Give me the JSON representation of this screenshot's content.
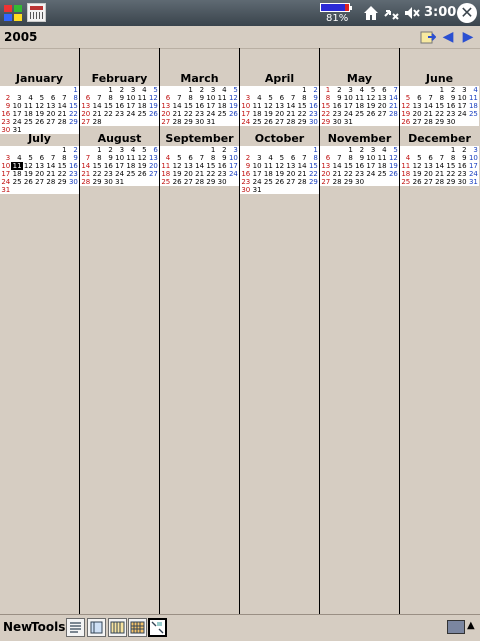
{
  "status": {
    "battery_label": "81%",
    "time": "3:00",
    "icons": [
      "windows-flag-icon",
      "calendar-app-icon",
      "battery-icon",
      "home-icon",
      "connectivity-icon",
      "volume-muted-icon",
      "close-icon"
    ]
  },
  "header": {
    "year": "2005",
    "today_icon": "go-to-today-icon",
    "prev_icon": "◀",
    "next_icon": "▶"
  },
  "months": [
    {
      "name": "January",
      "start": 6,
      "days": 31
    },
    {
      "name": "February",
      "start": 2,
      "days": 28
    },
    {
      "name": "March",
      "start": 2,
      "days": 31
    },
    {
      "name": "April",
      "start": 5,
      "days": 30
    },
    {
      "name": "May",
      "start": 0,
      "days": 31
    },
    {
      "name": "June",
      "start": 3,
      "days": 30
    },
    {
      "name": "July",
      "start": 5,
      "days": 31,
      "today": 11
    },
    {
      "name": "August",
      "start": 1,
      "days": 31
    },
    {
      "name": "September",
      "start": 4,
      "days": 30
    },
    {
      "name": "October",
      "start": 6,
      "days": 31
    },
    {
      "name": "November",
      "start": 2,
      "days": 30
    },
    {
      "name": "December",
      "start": 4,
      "days": 31
    }
  ],
  "toolbar": {
    "new_label": "New",
    "tools_label": "Tools",
    "views": [
      "agenda-view-icon",
      "day-view-icon",
      "week-view-icon",
      "month-view-icon",
      "year-view-icon"
    ],
    "active_view": "year-view-icon"
  },
  "colors": {
    "sunday": "#c01010",
    "saturday": "#1a3fbf",
    "background": "#d6cdc2"
  }
}
